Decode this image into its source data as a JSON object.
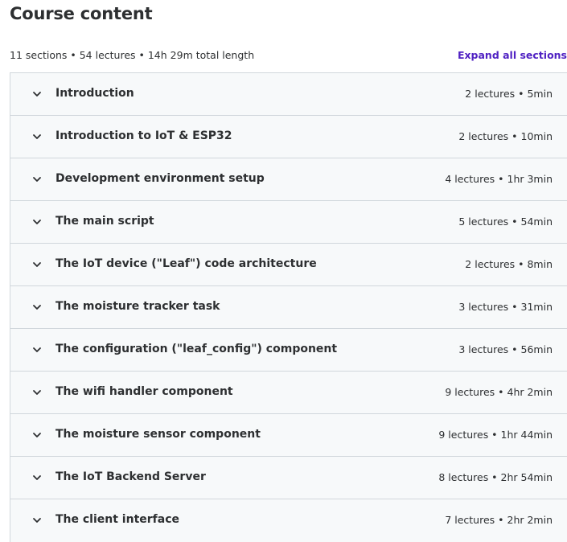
{
  "header": {
    "title": "Course content",
    "summary": "11 sections • 54 lectures • 14h 29m total length",
    "expand_all": "Expand all sections"
  },
  "sections": [
    {
      "title": "Introduction",
      "meta": "2 lectures • 5min"
    },
    {
      "title": "Introduction to IoT & ESP32",
      "meta": "2 lectures • 10min"
    },
    {
      "title": "Development environment setup",
      "meta": "4 lectures • 1hr 3min"
    },
    {
      "title": "The main script",
      "meta": "5 lectures • 54min"
    },
    {
      "title": "The IoT device (\"Leaf\") code architecture",
      "meta": "2 lectures • 8min"
    },
    {
      "title": "The moisture tracker task",
      "meta": "3 lectures • 31min"
    },
    {
      "title": "The configuration (\"leaf_config\") component",
      "meta": "3 lectures • 56min"
    },
    {
      "title": "The wifi handler component",
      "meta": "9 lectures • 4hr 2min"
    },
    {
      "title": "The moisture sensor component",
      "meta": "9 lectures • 1hr 44min"
    },
    {
      "title": "The IoT Backend Server",
      "meta": "8 lectures • 2hr 54min"
    },
    {
      "title": "The client interface",
      "meta": "7 lectures • 2hr 2min"
    }
  ],
  "icons": {
    "section_toggle": "chevron-down-icon"
  },
  "colors": {
    "accent": "#5022c3",
    "section_background": "#f7f9fa",
    "border": "#d1d7dc",
    "text": "#2d2f31"
  }
}
